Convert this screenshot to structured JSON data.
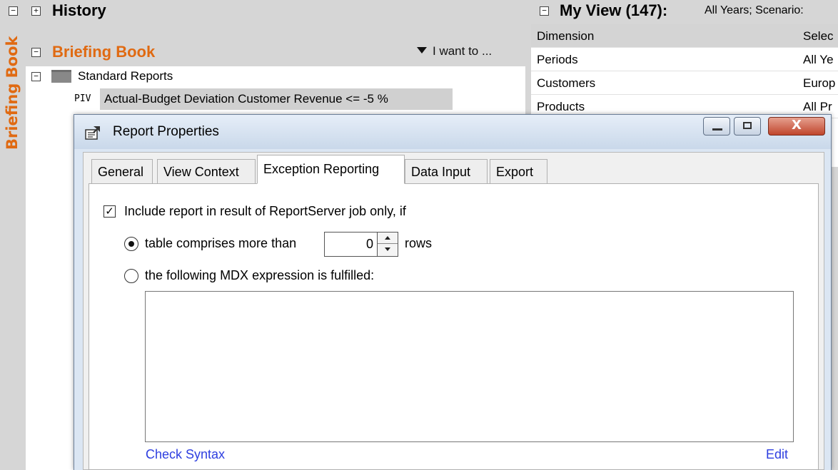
{
  "sidebar": {
    "label": "Briefing Book"
  },
  "history": {
    "expander": "+",
    "title": "History"
  },
  "briefing_book": {
    "expander": "−",
    "title": "Briefing Book",
    "i_want_to": "I want to ...",
    "folder": {
      "expander": "−",
      "label": "Standard Reports"
    },
    "item": {
      "type_tag": "PIV",
      "label": "Actual-Budget Deviation Customer Revenue <= -5 %"
    }
  },
  "my_view": {
    "expander": "−",
    "title": "My View (147):",
    "context": "All Years; Scenario:",
    "header": {
      "col1": "Dimension",
      "col2": "Selec"
    },
    "rows": [
      {
        "col1": "Periods",
        "col2": "All Ye"
      },
      {
        "col1": "Customers",
        "col2": "Europ"
      },
      {
        "col1": "Products",
        "col2": "All Pr"
      }
    ]
  },
  "dialog": {
    "title": "Report Properties",
    "close_glyph": "X",
    "tabs": [
      "General",
      "View Context",
      "Exception Reporting",
      "Data Input",
      "Export"
    ],
    "active_tab": "Exception Reporting",
    "include_checkbox": {
      "checked": true,
      "glyph": "✓",
      "label": "Include report in result of ReportServer job only, if"
    },
    "radio_rows": {
      "label": "table comprises more than",
      "value": "0",
      "suffix": "rows",
      "selected": true
    },
    "radio_mdx": {
      "label": "the following MDX expression is fulfilled:",
      "selected": false
    },
    "mdx_value": "",
    "check_syntax": "Check Syntax",
    "edit": "Edit"
  }
}
